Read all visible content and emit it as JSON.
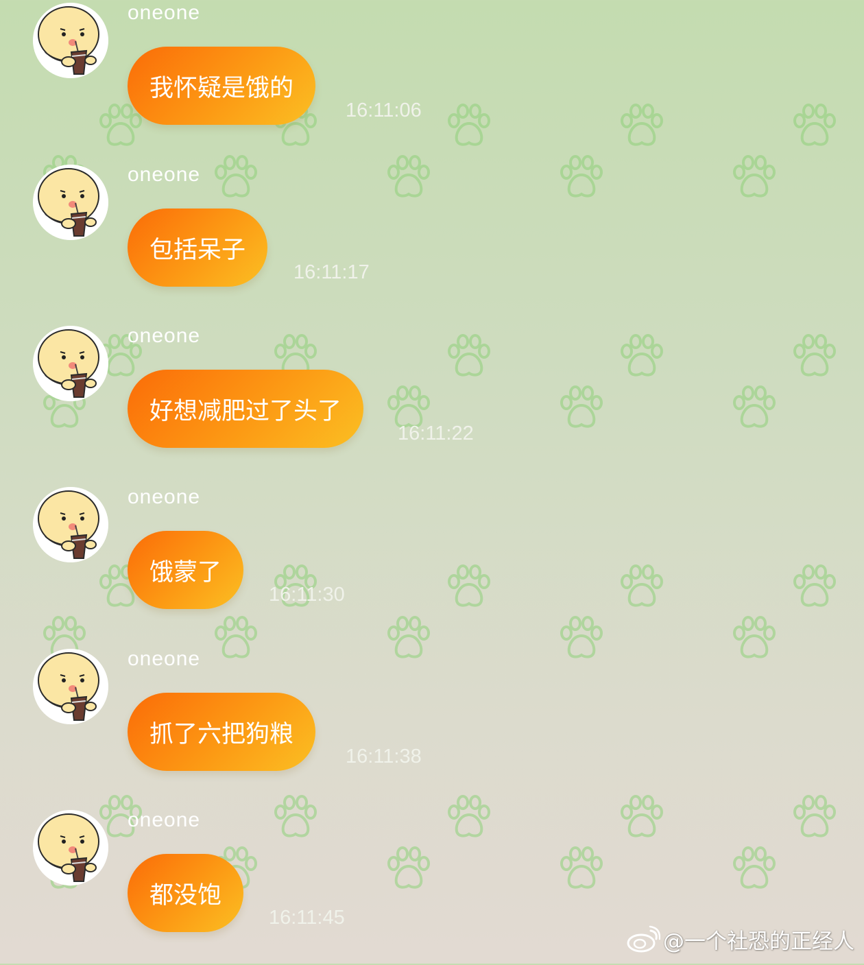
{
  "chat": {
    "messages": [
      {
        "sender": "oneone",
        "text": "我怀疑是饿的",
        "time": "16:11:06"
      },
      {
        "sender": "oneone",
        "text": "包括呆子",
        "time": "16:11:17"
      },
      {
        "sender": "oneone",
        "text": "好想减肥过了头了",
        "time": "16:11:22"
      },
      {
        "sender": "oneone",
        "text": "饿蒙了",
        "time": "16:11:30"
      },
      {
        "sender": "oneone",
        "text": "抓了六把狗粮",
        "time": "16:11:38"
      },
      {
        "sender": "oneone",
        "text": "都没饱",
        "time": "16:11:45"
      }
    ]
  },
  "watermark": {
    "text": "@一个社恐的正经人",
    "icon": "weibo-icon"
  },
  "colors": {
    "bubble_start": "#fb6c08",
    "bubble_end": "#fbbf23",
    "paw": "#8fd17a",
    "background_top": "#c4dcb0",
    "background_bottom": "#e2dad2"
  }
}
